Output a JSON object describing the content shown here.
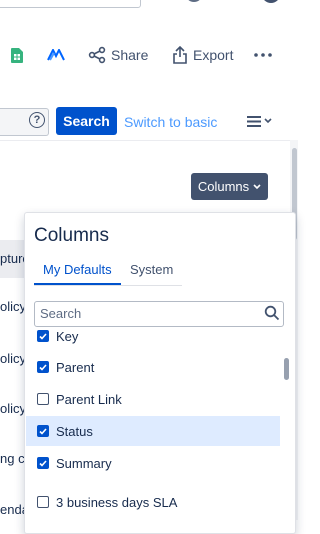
{
  "toolbar": {
    "share_label": "Share",
    "export_label": "Export"
  },
  "search": {
    "button_label": "Search",
    "switch_label": "Switch to basic",
    "help_glyph": "?"
  },
  "results": {
    "columns_button_label": "Columns",
    "row_fragments": [
      "pture",
      "olicy",
      "olicy",
      "olicy",
      "ng c",
      "enda"
    ]
  },
  "columns_popup": {
    "title": "Columns",
    "tabs": [
      {
        "label": "My Defaults",
        "active": true
      },
      {
        "label": "System",
        "active": false
      }
    ],
    "filter_placeholder": "Search",
    "options": [
      {
        "label": "Key",
        "checked": true,
        "highlighted": false
      },
      {
        "label": "Parent",
        "checked": true,
        "highlighted": false
      },
      {
        "label": "Parent Link",
        "checked": false,
        "highlighted": false
      },
      {
        "label": "Status",
        "checked": true,
        "highlighted": true
      },
      {
        "label": "Summary",
        "checked": true,
        "highlighted": false
      },
      {
        "label": "3 business days SLA",
        "checked": false,
        "highlighted": false
      }
    ]
  },
  "colors": {
    "primary": "#0052cc",
    "link": "#4c9aff",
    "columns_button_bg": "#42526e",
    "row_highlight": "#deebff"
  },
  "icons": [
    "spreadsheet-icon",
    "gantt-icon",
    "share-icon",
    "export-icon",
    "more-icon",
    "help-icon",
    "list-view-icon",
    "chevron-down-icon",
    "search-icon",
    "checkbox-checked-icon",
    "checkbox-unchecked-icon"
  ]
}
